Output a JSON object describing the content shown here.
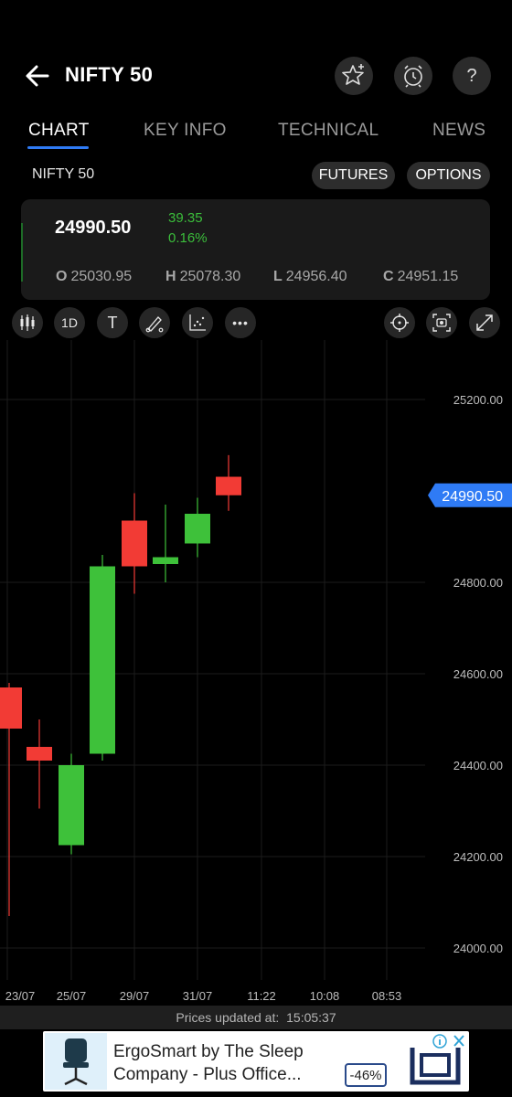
{
  "header": {
    "title": "NIFTY 50",
    "icons": [
      "back-arrow-icon",
      "star-add-icon",
      "alarm-clock-icon",
      "help-icon"
    ]
  },
  "tabs": [
    {
      "label": "CHART",
      "active": true
    },
    {
      "label": "KEY INFO",
      "active": false
    },
    {
      "label": "TECHNICAL",
      "active": false
    },
    {
      "label": "NEWS",
      "active": false
    }
  ],
  "subrow": {
    "symbol": "NIFTY 50",
    "futures_label": "FUTURES",
    "options_label": "OPTIONS"
  },
  "quote": {
    "last_price": "24990.50",
    "change": "39.35",
    "change_pct": "0.16%",
    "open_label": "O",
    "open": "25030.95",
    "high_label": "H",
    "high": "25078.30",
    "low_label": "L",
    "low": "24956.40",
    "close_label": "C",
    "close": "24951.15"
  },
  "toolbar": {
    "interval": "1D",
    "text_tool": "T",
    "more": "•••",
    "icons": [
      "candlestick-icon",
      "text-icon",
      "draw-pen-icon",
      "indicator-icon",
      "more-icon",
      "crosshair-icon",
      "screenshot-icon",
      "fullscreen-icon"
    ]
  },
  "chart_data": {
    "type": "candlestick",
    "y_ticks": [
      "25200.00",
      "24800.00",
      "24600.00",
      "24400.00",
      "24200.00",
      "24000.00"
    ],
    "ylim": [
      23930,
      25330
    ],
    "x_tick_labels": [
      "23/07",
      "25/07",
      "29/07",
      "31/07",
      "11:22",
      "10:08",
      "08:53"
    ],
    "current_price_label": "24990.50",
    "up_color": "#3ec13a",
    "down_color": "#f23b35",
    "candles": [
      {
        "open": 24570,
        "high": 24580,
        "low": 24070,
        "close": 24480
      },
      {
        "open": 24440,
        "high": 24500,
        "low": 24305,
        "close": 24410
      },
      {
        "open": 24225,
        "high": 24425,
        "low": 24205,
        "close": 24400
      },
      {
        "open": 24425,
        "high": 24860,
        "low": 24410,
        "close": 24835
      },
      {
        "open": 24935,
        "high": 24995,
        "low": 24775,
        "close": 24835
      },
      {
        "open": 24840,
        "high": 24970,
        "low": 24800,
        "close": 24855
      },
      {
        "open": 24885,
        "high": 24985,
        "low": 24855,
        "close": 24950
      },
      {
        "open": 25030.95,
        "high": 25078.3,
        "low": 24956.4,
        "close": 24990.5
      }
    ]
  },
  "footer": {
    "updated_label": "Prices updated at:",
    "updated_time": "15:05:37"
  },
  "ad": {
    "text": "ErgoSmart by The Sleep Company - Plus Office...",
    "badge": "-46%",
    "info_icon": "info-icon",
    "close_icon": "close-icon"
  }
}
